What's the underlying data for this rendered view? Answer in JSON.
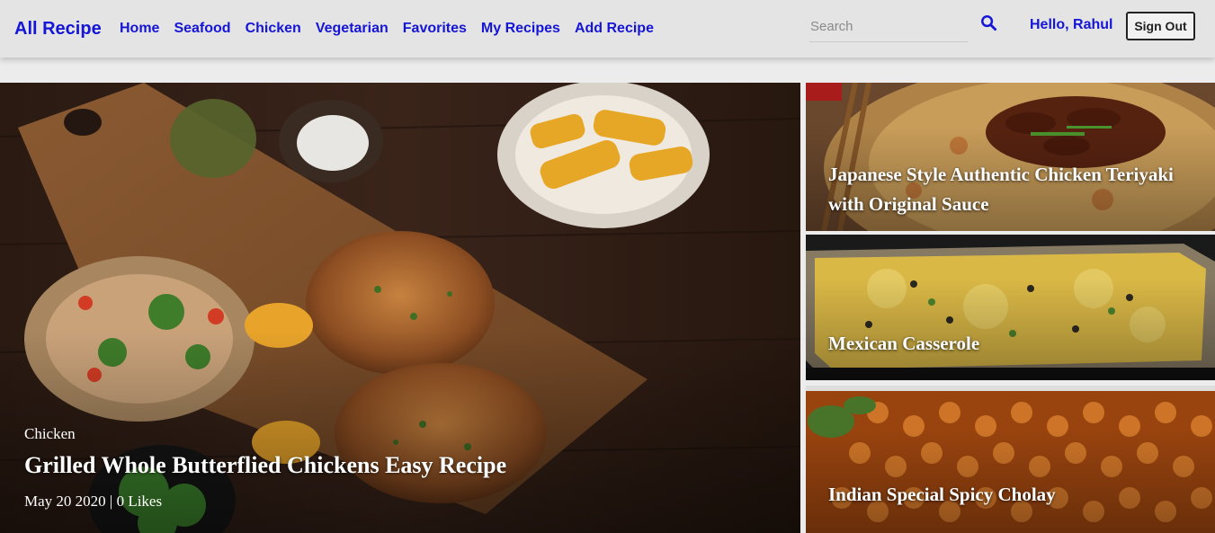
{
  "navbar": {
    "brand": "All Recipe",
    "links": [
      "Home",
      "Seafood",
      "Chicken",
      "Vegetarian",
      "Favorites",
      "My Recipes",
      "Add Recipe"
    ],
    "search_placeholder": "Search",
    "search_icon": "search-icon",
    "greeting": "Hello, Rahul",
    "signout_label": "Sign Out"
  },
  "featured": {
    "category": "Chicken",
    "title": "Grilled Whole Butterflied Chickens Easy Recipe",
    "meta": "May 20 2020 | 0 Likes"
  },
  "side_recipes": [
    {
      "title": "Japanese Style Authentic Chicken Teriyaki with Original Sauce"
    },
    {
      "title": "Mexican Casserole"
    },
    {
      "title": "Indian Special Spicy Cholay"
    }
  ],
  "colors": {
    "link": "#1515d6",
    "navbar_bg": "#e4e4e4",
    "page_bg": "#ececec"
  }
}
